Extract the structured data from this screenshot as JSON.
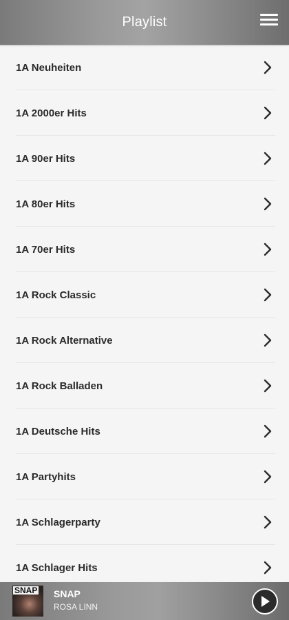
{
  "header": {
    "title": "Playlist",
    "menu_icon": "hamburger-menu-icon"
  },
  "playlist": {
    "items": [
      {
        "label": "1A Neuheiten"
      },
      {
        "label": "1A 2000er Hits"
      },
      {
        "label": "1A 90er Hits"
      },
      {
        "label": "1A 80er Hits"
      },
      {
        "label": "1A 70er Hits"
      },
      {
        "label": "1A Rock Classic"
      },
      {
        "label": "1A Rock Alternative"
      },
      {
        "label": "1A Rock Balladen"
      },
      {
        "label": "1A Deutsche Hits"
      },
      {
        "label": "1A Partyhits"
      },
      {
        "label": "1A Schlagerparty"
      },
      {
        "label": "1A Schlager Hits"
      }
    ],
    "chevron_icon": "chevron-right-icon"
  },
  "player": {
    "album_art_text": "SNAP",
    "track_title": "SNAP",
    "artist": "ROSA LINN",
    "play_icon": "play-icon"
  },
  "colors": {
    "header_gray": "#9a9a9a",
    "background": "#f5f5f5",
    "text": "#2a2a2a",
    "play_button": "#2b2b2b"
  }
}
